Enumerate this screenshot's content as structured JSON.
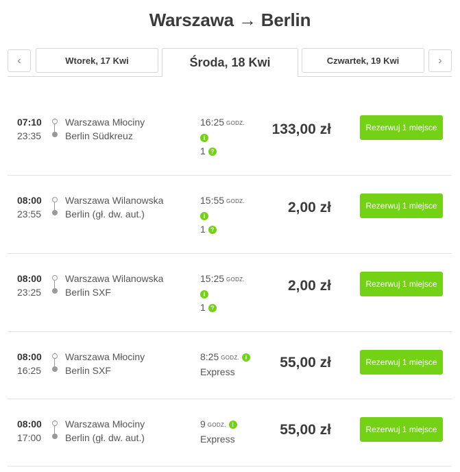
{
  "route": {
    "origin": "Warszawa",
    "arrow": "→",
    "destination": "Berlin"
  },
  "dates": {
    "prev_arrow": "‹",
    "next_arrow": "›",
    "prev_day": "Wtorek, 17 Kwi",
    "selected_day": "Środa, 18 Kwi",
    "next_day": "Czwartek, 19 Kwi"
  },
  "labels": {
    "duration_unit": "GODZ.",
    "book": "Rezerwuj 1 miejsce"
  },
  "colors": {
    "accent": "#73d216",
    "title": "#3b3b3b"
  },
  "connections": [
    {
      "departure": "07:10",
      "arrival": "23:35",
      "from": "Warszawa Młociny",
      "to": "Berlin Südkreuz",
      "duration": "16:25",
      "transfers": "1",
      "type": "",
      "price": "133,00 zł"
    },
    {
      "departure": "08:00",
      "arrival": "23:55",
      "from": "Warszawa Wilanowska",
      "to": "Berlin (gł. dw. aut.)",
      "duration": "15:55",
      "transfers": "1",
      "type": "",
      "price": "2,00 zł"
    },
    {
      "departure": "08:00",
      "arrival": "23:25",
      "from": "Warszawa Wilanowska",
      "to": "Berlin SXF",
      "duration": "15:25",
      "transfers": "1",
      "type": "",
      "price": "2,00 zł"
    },
    {
      "departure": "08:00",
      "arrival": "16:25",
      "from": "Warszawa Młociny",
      "to": "Berlin SXF",
      "duration": "8:25",
      "transfers": "",
      "type": "Express",
      "price": "55,00 zł"
    },
    {
      "departure": "08:00",
      "arrival": "17:00",
      "from": "Warszawa Młociny",
      "to": "Berlin (gł. dw. aut.)",
      "duration": "9",
      "transfers": "",
      "type": "Express",
      "price": "55,00 zł"
    }
  ]
}
